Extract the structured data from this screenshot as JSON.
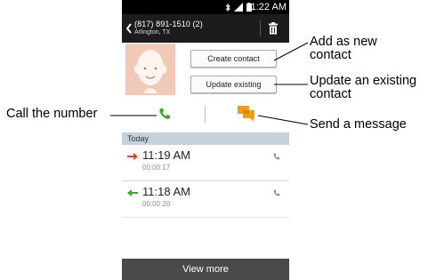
{
  "status_bar": {
    "time": "11:22 AM",
    "icons": [
      "bluetooth-icon",
      "signal-icon",
      "battery-icon"
    ]
  },
  "app_bar": {
    "phone_number": "(817) 891-1510 (2)",
    "location": "Arlington, TX",
    "icons": [
      "back-icon",
      "trash-icon"
    ]
  },
  "actions": {
    "create_contact": "Create contact",
    "update_existing": "Update existing",
    "icons": [
      "call-icon",
      "message-icon"
    ]
  },
  "log": {
    "section_title": "Today",
    "entries": [
      {
        "time": "11:19 AM",
        "duration": "00:00:17",
        "direction": "outgoing"
      },
      {
        "time": "11:18 AM",
        "duration": "00:00:20",
        "direction": "incoming"
      }
    ]
  },
  "footer": {
    "view_more": "View more"
  },
  "callouts": {
    "add_new_contact": "Add as new contact",
    "update_existing_contact": "Update an existing contact",
    "call_number": "Call the number",
    "send_message": "Send a message"
  },
  "colors": {
    "status_bar": "#000000",
    "app_bar": "#1c1c1c",
    "call_green": "#3aa534",
    "message_orange": "#f39c12",
    "outgoing_arrow": "#e0442c",
    "incoming_arrow": "#3aa534",
    "section_header": "#c3d2dd",
    "footer": "#4a4a4a"
  }
}
